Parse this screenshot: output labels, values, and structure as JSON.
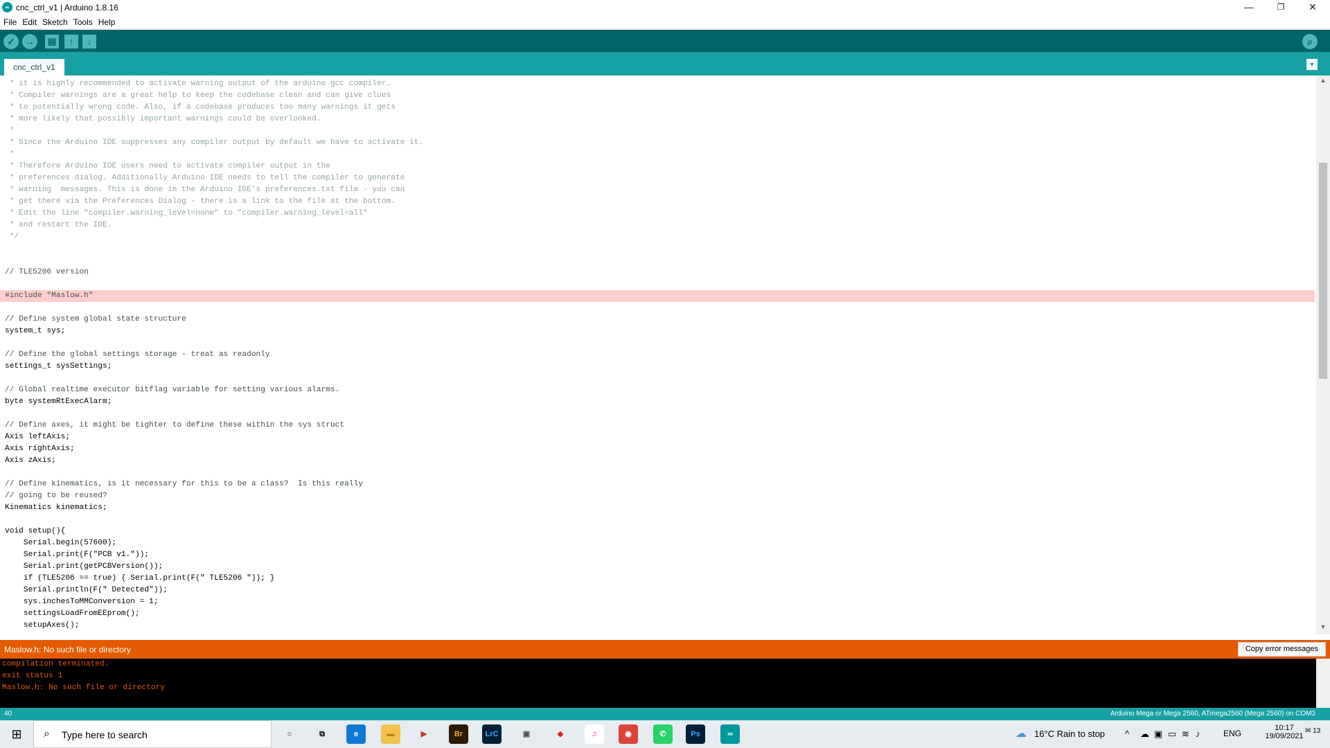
{
  "window": {
    "title": "cnc_ctrl_v1 | Arduino 1.8.16",
    "minimize": "—",
    "restore": "❐",
    "close": "✕"
  },
  "menu": [
    "File",
    "Edit",
    "Sketch",
    "Tools",
    "Help"
  ],
  "toolbar": {
    "verify_icon": "✓",
    "upload_icon": "→",
    "new_icon": "▤",
    "open_icon": "↑",
    "save_icon": "↓",
    "serial_icon": "⌕"
  },
  "tab": {
    "label": "cnc_ctrl_v1",
    "menu_icon": "▼"
  },
  "code_lines": [
    {
      "t": " * it is highly recommended to activate warning output of the arduino gcc compiler.",
      "c": "c-comment"
    },
    {
      "t": " * Compiler warnings are a great help to keep the codebase clean and can give clues",
      "c": "c-comment"
    },
    {
      "t": " * to potentially wrong code. Also, if a codebase produces too many warnings it gets",
      "c": "c-comment"
    },
    {
      "t": " * more likely that possibly important warnings could be overlooked.",
      "c": "c-comment"
    },
    {
      "t": " *",
      "c": "c-comment"
    },
    {
      "t": " * Since the Arduino IDE suppresses any compiler output by default we have to activate it.",
      "c": "c-comment"
    },
    {
      "t": " *",
      "c": "c-comment"
    },
    {
      "t": " * Therefore Arduino IDE users need to activate compiler output in the",
      "c": "c-comment"
    },
    {
      "t": " * preferences dialog. Additionally Arduino IDE needs to tell the compiler to generate",
      "c": "c-comment"
    },
    {
      "t": " * warning  messages. This is done in the Arduino IDE's preferences.txt file - you can",
      "c": "c-comment"
    },
    {
      "t": " * get there via the Preferences Dialog - there is a link to the file at the bottom.",
      "c": "c-comment"
    },
    {
      "t": " * Edit the line \"compiler.warning_level=none\" to \"compiler.warning_level=all\"",
      "c": "c-comment"
    },
    {
      "t": " * and restart the IDE.",
      "c": "c-comment"
    },
    {
      "t": " */",
      "c": "c-comment"
    },
    {
      "t": "",
      "c": "c-code"
    },
    {
      "t": "",
      "c": "c-code"
    },
    {
      "t": "// TLE5206 version",
      "c": "c-comment2"
    },
    {
      "t": "",
      "c": "c-code"
    },
    {
      "t": "#include \"Maslow.h\"",
      "c": "c-err"
    },
    {
      "t": "",
      "c": "c-code"
    },
    {
      "t": "// Define system global state structure",
      "c": "c-comment2"
    },
    {
      "t": "system_t sys;",
      "c": "c-code"
    },
    {
      "t": "",
      "c": "c-code"
    },
    {
      "t": "// Define the global settings storage - treat as readonly",
      "c": "c-comment2"
    },
    {
      "t": "settings_t sysSettings;",
      "c": "c-code"
    },
    {
      "t": "",
      "c": "c-code"
    },
    {
      "t": "// Global realtime executor bitflag variable for setting various alarms.",
      "c": "c-comment2"
    },
    {
      "t": "byte systemRtExecAlarm;",
      "c": "c-code"
    },
    {
      "t": "",
      "c": "c-code"
    },
    {
      "t": "// Define axes, it might be tighter to define these within the sys struct",
      "c": "c-comment2"
    },
    {
      "t": "Axis leftAxis;",
      "c": "c-code"
    },
    {
      "t": "Axis rightAxis;",
      "c": "c-code"
    },
    {
      "t": "Axis zAxis;",
      "c": "c-code"
    },
    {
      "t": "",
      "c": "c-code"
    },
    {
      "t": "// Define kinematics, is it necessary for this to be a class?  Is this really",
      "c": "c-comment2"
    },
    {
      "t": "// going to be reused?",
      "c": "c-comment2"
    },
    {
      "t": "Kinematics kinematics;",
      "c": "c-code"
    },
    {
      "t": "",
      "c": "c-code"
    },
    {
      "t": "void setup(){",
      "c": "c-code"
    },
    {
      "t": "    Serial.begin(57600);",
      "c": "c-code"
    },
    {
      "t": "    Serial.print(F(\"PCB v1.\"));",
      "c": "c-code"
    },
    {
      "t": "    Serial.print(getPCBVersion());",
      "c": "c-code"
    },
    {
      "t": "    if (TLE5206 == true) { Serial.print(F(\" TLE5206 \")); }",
      "c": "c-code"
    },
    {
      "t": "    Serial.println(F(\" Detected\"));",
      "c": "c-code"
    },
    {
      "t": "    sys.inchesToMMConversion = 1;",
      "c": "c-code"
    },
    {
      "t": "    settingsLoadFromEEprom();",
      "c": "c-code"
    },
    {
      "t": "    setupAxes();",
      "c": "c-code"
    }
  ],
  "error_bar": {
    "message": "Maslow.h: No such file or directory",
    "copy_button": "Copy error messages"
  },
  "console_lines": [
    "compilation terminated.",
    "exit status 1",
    "Maslow.h: No such file or directory"
  ],
  "status": {
    "line_number": "40",
    "board": "Arduino Mega or Mega 2560, ATmega2560 (Mega 2560) on COM3"
  },
  "taskbar": {
    "start_icon": "⊞",
    "search_icon": "⌕",
    "search_placeholder": "Type here to search",
    "apps": [
      {
        "name": "cortana-icon",
        "label": "○",
        "bg": "transparent",
        "fg": "#000"
      },
      {
        "name": "task-view-icon",
        "label": "⧉",
        "bg": "transparent",
        "fg": "#000"
      },
      {
        "name": "edge-icon",
        "label": "e",
        "bg": "#0f7ad6",
        "fg": "#fff"
      },
      {
        "name": "file-explorer-icon",
        "label": "▬",
        "bg": "#f2c14e",
        "fg": "#b98400"
      },
      {
        "name": "video-editor-icon",
        "label": "▶",
        "bg": "#e6ecf0",
        "fg": "#c0392b"
      },
      {
        "name": "bridge-icon",
        "label": "Br",
        "bg": "#2b1a00",
        "fg": "#e8a33d"
      },
      {
        "name": "lightroom-classic-icon",
        "label": "LrC",
        "bg": "#001e36",
        "fg": "#31a8ff"
      },
      {
        "name": "devices-icon",
        "label": "▣",
        "bg": "#e6ecf0",
        "fg": "#555"
      },
      {
        "name": "sketchup-icon",
        "label": "◆",
        "bg": "#e6ecf0",
        "fg": "#d22"
      },
      {
        "name": "itunes-icon",
        "label": "♫",
        "bg": "#fff",
        "fg": "#e93ca0"
      },
      {
        "name": "chrome-icon",
        "label": "◉",
        "bg": "#db4437",
        "fg": "#fff"
      },
      {
        "name": "whatsapp-icon",
        "label": "✆",
        "bg": "#25d366",
        "fg": "#fff"
      },
      {
        "name": "photoshop-icon",
        "label": "Ps",
        "bg": "#001e36",
        "fg": "#31a8ff"
      },
      {
        "name": "arduino-icon",
        "label": "∞",
        "bg": "#00979d",
        "fg": "#fff"
      }
    ],
    "weather": "16°C  Rain to stop",
    "weather_icon": "☁",
    "chevron_icon": "^",
    "language": "ENG",
    "time": "10:17",
    "date": "19/09/2021",
    "notifications_count": "13"
  }
}
